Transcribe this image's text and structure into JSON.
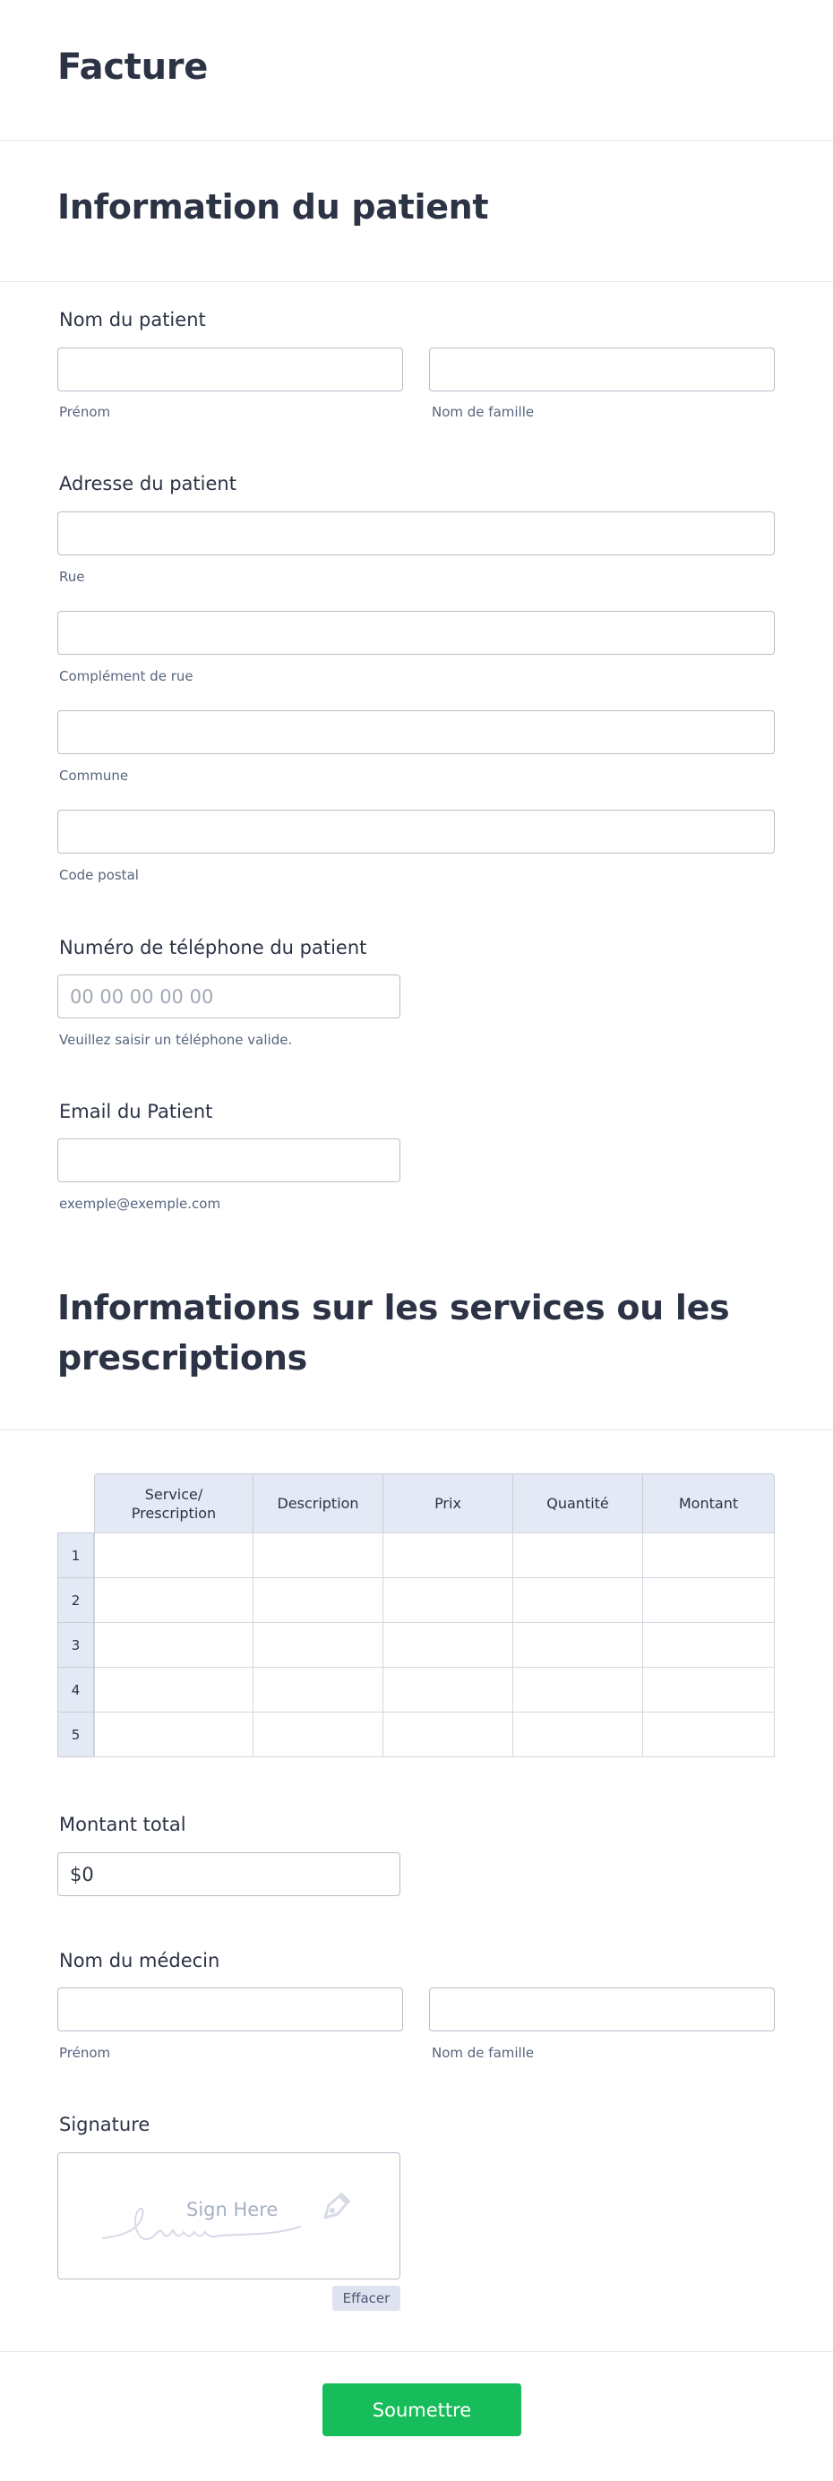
{
  "form_title": "Facture",
  "patient_section": {
    "heading": "Information du patient",
    "name": {
      "label": "Nom du patient",
      "first_sublabel": "Prénom",
      "last_sublabel": "Nom de famille",
      "first_value": "",
      "last_value": ""
    },
    "address": {
      "label": "Adresse du patient",
      "street_sublabel": "Rue",
      "street2_sublabel": "Complément de rue",
      "city_sublabel": "Commune",
      "postal_sublabel": "Code postal"
    },
    "phone": {
      "label": "Numéro de téléphone du patient",
      "placeholder": "00 00 00 00 00",
      "sublabel": "Veuillez saisir un téléphone valide."
    },
    "email": {
      "label": "Email du Patient",
      "sublabel": "exemple@exemple.com",
      "value": ""
    }
  },
  "services_section": {
    "heading_line1": "Informations sur les services ou les",
    "heading_line2": "prescriptions",
    "table": {
      "columns": [
        "Service/ Prescription",
        "Description",
        "Prix",
        "Quantité",
        "Montant"
      ],
      "rows": [
        "1",
        "2",
        "3",
        "4",
        "5"
      ]
    },
    "total": {
      "label": "Montant total",
      "value": "$0"
    },
    "doctor": {
      "label": "Nom du médecin",
      "first_sublabel": "Prénom",
      "last_sublabel": "Nom de famille"
    },
    "signature": {
      "label": "Signature",
      "pad_text": "Sign Here",
      "clear_label": "Effacer"
    }
  },
  "submit_label": "Soumettre",
  "colors": {
    "accent": "#18bd5b",
    "header_fill": "#e5e9f5",
    "text": "#2c3345"
  },
  "icons": {
    "signature_pen": "pen-nib-icon",
    "signature_scribble": "scribble-icon"
  }
}
